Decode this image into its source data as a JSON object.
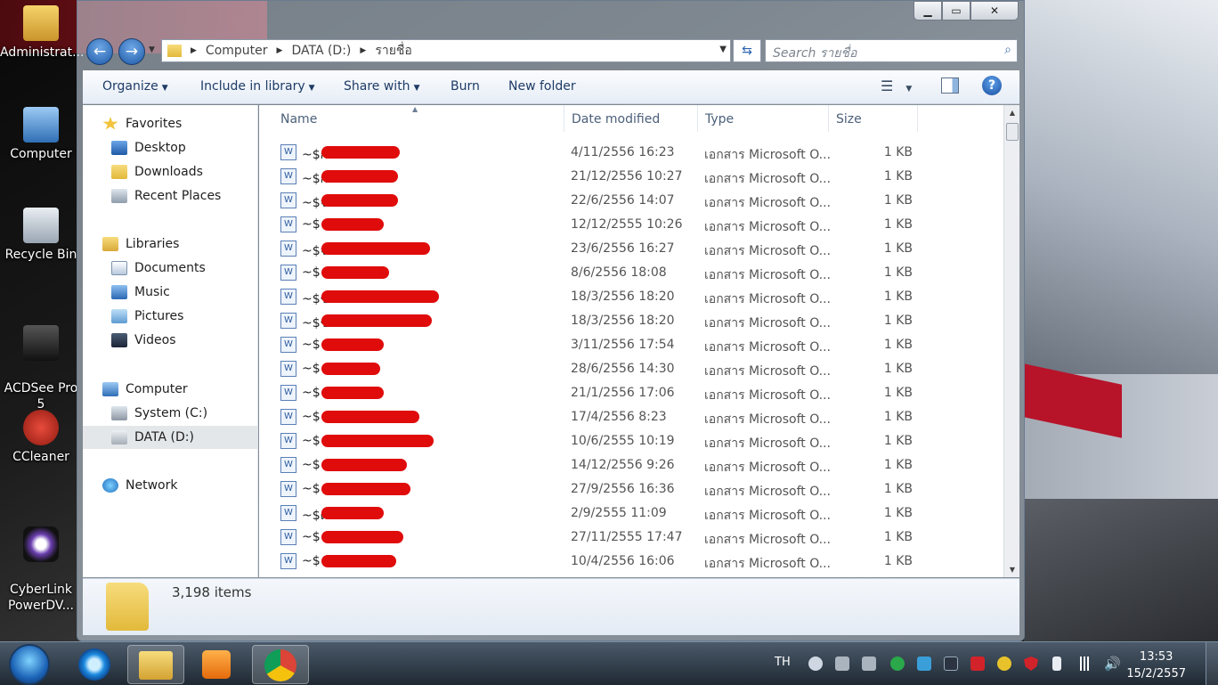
{
  "window": {
    "title": "รายชื่อ"
  },
  "desktop_icons": [
    {
      "label": "Administrat..."
    },
    {
      "label": "Computer"
    },
    {
      "label": "Recycle Bin"
    },
    {
      "label": "ACDSee Pro\n5"
    },
    {
      "label": "CCleaner"
    },
    {
      "label": "CyberLink\nPowerDV..."
    }
  ],
  "address_bar": {
    "crumbs": [
      "Computer",
      "DATA (D:)",
      "รายชื่อ"
    ]
  },
  "search": {
    "placeholder": "Search รายชื่อ"
  },
  "toolbar": {
    "organize": "Organize",
    "include_in_library": "Include in library",
    "share_with": "Share with",
    "burn": "Burn",
    "new_folder": "New folder"
  },
  "nav": {
    "favorites": "Favorites",
    "desktop": "Desktop",
    "downloads": "Downloads",
    "recent_places": "Recent Places",
    "libraries": "Libraries",
    "documents": "Documents",
    "music": "Music",
    "pictures": "Pictures",
    "videos": "Videos",
    "computer": "Computer",
    "system_c": "System (C:)",
    "data_d": "DATA (D:)",
    "network": "Network"
  },
  "columns": {
    "name": "Name",
    "date_modified": "Date modified",
    "type": "Type",
    "size": "Size"
  },
  "files": [
    {
      "name": "~$ก",
      "date": "4/11/2556 16:23",
      "type": "เอกสาร Microsoft O...",
      "size": "1 KB"
    },
    {
      "name": "~$ก",
      "date": "21/12/2556 10:27",
      "type": "เอกสาร Microsoft O...",
      "size": "1 KB"
    },
    {
      "name": "~$จ",
      "date": "22/6/2556 14:07",
      "type": "เอกสาร Microsoft O...",
      "size": "1 KB"
    },
    {
      "name": "~$",
      "date": "12/12/2555 10:26",
      "type": "เอกสาร Microsoft O...",
      "size": "1 KB"
    },
    {
      "name": "~$จ",
      "date": "23/6/2556 16:27",
      "type": "เอกสาร Microsoft O...",
      "size": "1 KB"
    },
    {
      "name": "~$",
      "date": "8/6/2556 18:08",
      "type": "เอกสาร Microsoft O...",
      "size": "1 KB"
    },
    {
      "name": "~$ช",
      "date": "18/3/2556 18:20",
      "type": "เอกสาร Microsoft O...",
      "size": "1 KB"
    },
    {
      "name": "~$ช",
      "date": "18/3/2556 18:20",
      "type": "เอกสาร Microsoft O...",
      "size": "1 KB"
    },
    {
      "name": "~$",
      "date": "3/11/2556 17:54",
      "type": "เอกสาร Microsoft O...",
      "size": "1 KB"
    },
    {
      "name": "~$",
      "date": "28/6/2556 14:30",
      "type": "เอกสาร Microsoft O...",
      "size": "1 KB"
    },
    {
      "name": "~$",
      "date": "21/1/2556 17:06",
      "type": "เอกสาร Microsoft O...",
      "size": "1 KB"
    },
    {
      "name": "~$",
      "date": "17/4/2556 8:23",
      "type": "เอกสาร Microsoft O...",
      "size": "1 KB"
    },
    {
      "name": "~$",
      "date": "10/6/2555 10:19",
      "type": "เอกสาร Microsoft O...",
      "size": "1 KB"
    },
    {
      "name": "~$",
      "date": "14/12/2556 9:26",
      "type": "เอกสาร Microsoft O...",
      "size": "1 KB"
    },
    {
      "name": "~$",
      "date": "27/9/2556 16:36",
      "type": "เอกสาร Microsoft O...",
      "size": "1 KB"
    },
    {
      "name": "~$ต",
      "date": "2/9/2555 11:09",
      "type": "เอกสาร Microsoft O...",
      "size": "1 KB"
    },
    {
      "name": "~$",
      "date": "27/11/2555 17:47",
      "type": "เอกสาร Microsoft O...",
      "size": "1 KB"
    },
    {
      "name": "~$",
      "date": "10/4/2556 16:06",
      "type": "เอกสาร Microsoft O...",
      "size": "1 KB"
    }
  ],
  "details": {
    "count": "3,198 items"
  },
  "taskbar": {
    "language": "TH",
    "time": "13:53",
    "date": "15/2/2557"
  },
  "colors": {
    "redaction": "#e00b0b",
    "accent": "#1e3b66"
  }
}
